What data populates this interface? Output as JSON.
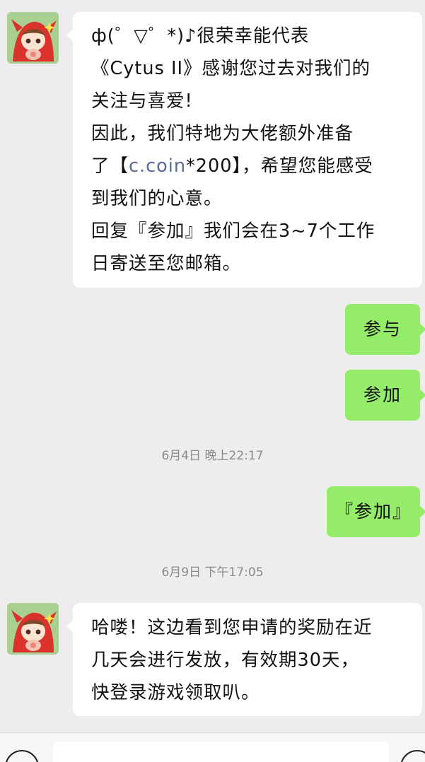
{
  "messages": [
    {
      "from": "other",
      "lines": {
        "l1": "ф(゜▽゜*)♪很荣幸能代表",
        "l2": "《Cytus II》感谢您过去对我们的",
        "l3": "关注与喜爱!",
        "l4": "因此，我们特地为大佬额外准备",
        "l5_pre": "了【",
        "l5_link": "c.coin",
        "l5_post": "*200】，希望您能感受",
        "l6": "到我们的心意。",
        "l7": "回复『参加』我们会在3~7个工作",
        "l8": "日寄送至您邮箱。"
      }
    },
    {
      "from": "me",
      "text": "参与"
    },
    {
      "from": "me",
      "text": "参加"
    },
    {
      "from": "me",
      "text": "『参加』"
    },
    {
      "from": "other",
      "lines": {
        "l1": "哈喽！这边看到您申请的奖励在近",
        "l2": "几天会进行发放，有效期30天，",
        "l3": "快登录游戏领取叭。"
      }
    }
  ],
  "timestamps": {
    "t1": "6月4日 晚上22:17",
    "t2": "6月9日 下午17:05"
  },
  "colors": {
    "background": "#ededed",
    "bubble_me": "#95ec69",
    "bubble_other": "#ffffff",
    "link": "#5b6a96"
  },
  "icons": {
    "voice": "voice-icon",
    "emoji": "emoji-icon",
    "avatar": "anime-character-avatar"
  }
}
